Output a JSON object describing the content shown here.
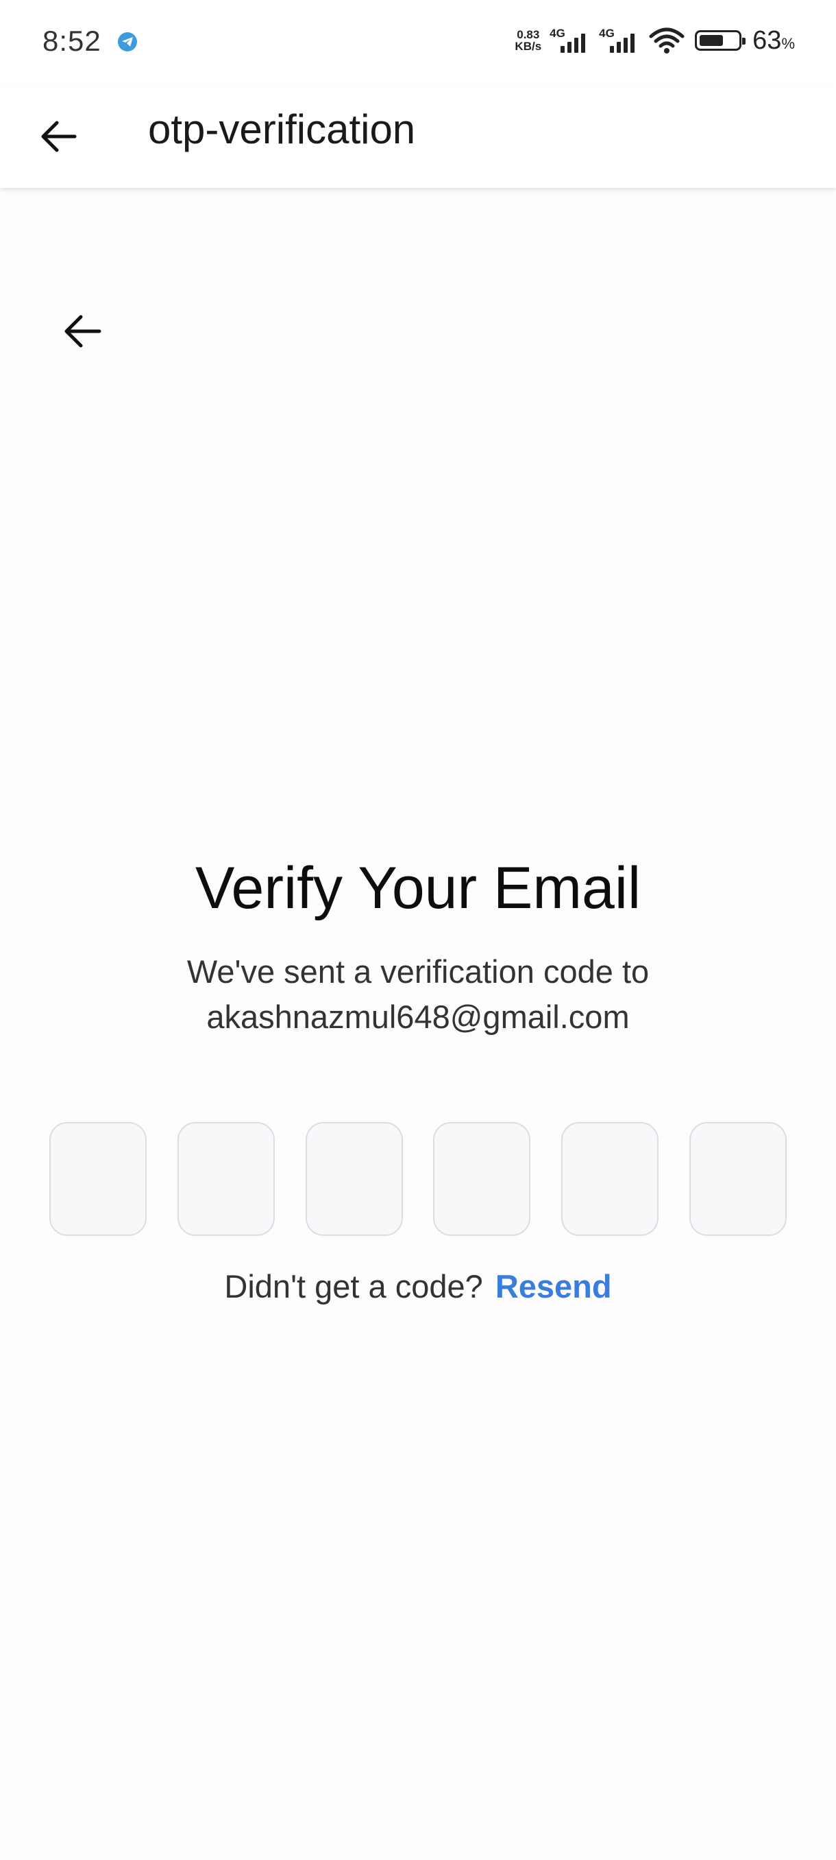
{
  "status_bar": {
    "time": "8:52",
    "net_speed_value": "0.83",
    "net_speed_unit": "KB/s",
    "sim1_type": "4G",
    "sim2_type": "4G",
    "battery_percent": "63",
    "battery_percent_sign": "%",
    "battery_level": 0.63
  },
  "app_bar": {
    "title": "otp-verification"
  },
  "verify": {
    "title": "Verify Your Email",
    "subtitle_line1": "We've sent a verification code to",
    "email": "akashnazmul648@gmail.com",
    "otp_digits": [
      "",
      "",
      "",
      "",
      "",
      ""
    ],
    "resend_prompt": "Didn't get a code?",
    "resend_label": "Resend"
  },
  "colors": {
    "link": "#3b7ddd",
    "otp_border": "#dadde2",
    "otp_fill": "#f7f8fa"
  },
  "icons": {
    "app_bar_back": "arrow-left-icon",
    "content_back": "arrow-left-icon",
    "notification": "telegram-icon"
  }
}
